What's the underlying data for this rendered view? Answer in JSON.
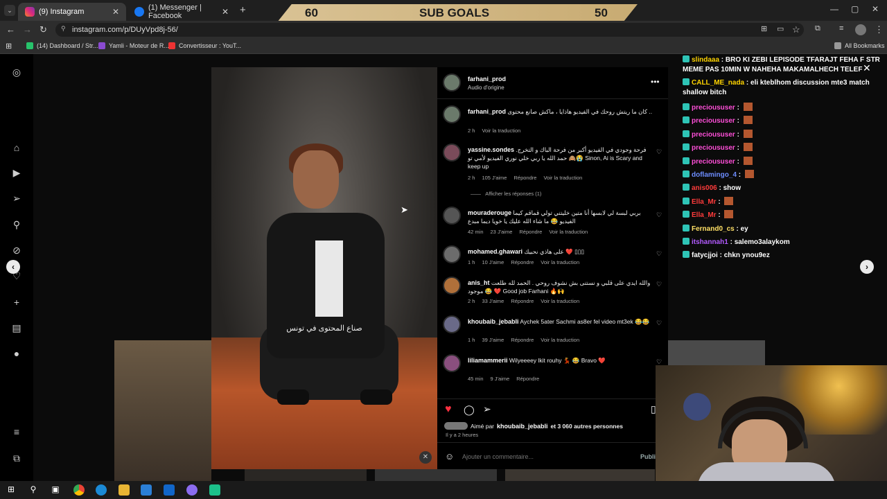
{
  "browser": {
    "tabs": [
      {
        "label": "(9) Instagram",
        "active": true
      },
      {
        "label": "(1) Messenger | Facebook",
        "active": false
      }
    ],
    "url": "instagram.com/p/DUyVpd8j-56/",
    "bookmarks": [
      "(14) Dashboard / Str...",
      "Yamli - Moteur de R...",
      "Convertisseur : YouT..."
    ],
    "all_bookmarks": "All Bookmarks"
  },
  "overlay": {
    "left_number": "60",
    "title": "SUB GOALS",
    "right_number": "50"
  },
  "video": {
    "caption": "صناع المحتوى في تونس"
  },
  "post": {
    "username": "farhani_prod",
    "audio": "Audio d'origine",
    "caption_user": "farhani_prod",
    "caption_text": "كان ما ريتش روحك في الفيديو هاذايا ، ماكش صانع محتوى ..",
    "caption_time": "2 h",
    "translate": "Voir la traduction",
    "comments": [
      {
        "user": "yassine.sondes",
        "text": "فرحة وجودي في الفيديو أكبر من فرحة الباك و التخرج. حمد الله يا ربي خلي نوري الفيديو لأمي تو 🙈😭 Sinon, Ai is Scary and keep up",
        "time": "2 h",
        "likes": "105 J'aime",
        "reply": "Répondre",
        "translate": "Voir la traduction"
      },
      {
        "user": "mouraderouge",
        "text": "بربي لبسة لي لابسها أنا متين خليتني تولي قماقم كيما الفيديو 😂 ما شاء الله عليك يا خويا ديما مبدع",
        "time": "42 min",
        "likes": "23 J'aime",
        "reply": "Répondre",
        "translate": "Voir la traduction"
      },
      {
        "user": "mohamed.ghawari",
        "text": "على هاذي نحبيك ❤️ ▯▯▯",
        "time": "1 h",
        "likes": "10 J'aime",
        "reply": "Répondre",
        "translate": "Voir la traduction"
      },
      {
        "user": "anis_ht",
        "text": "والله ايدي على قلبي و نستنى بش نشوف روحي . الحمد لله طلعت موجود 😂 ❤️ Good job Farhani 🔥🙌",
        "time": "2 h",
        "likes": "33 J'aime",
        "reply": "Répondre",
        "translate": "Voir la traduction"
      },
      {
        "user": "khoubaib_jebabli",
        "text": "Aychek 5ater Sachmi as8er fel video mt3ek 😂😂",
        "time": "1 h",
        "likes": "39 J'aime",
        "reply": "Répondre",
        "translate": "Voir la traduction"
      },
      {
        "user": "liliamammerii",
        "text": "Wilyeeeey lkit rouhy 💃 😂 Bravo ❤️",
        "time": "45 min",
        "likes": "9 J'aime",
        "reply": "Répondre",
        "translate": ""
      }
    ],
    "show_replies": "Afficher les réponses (1)",
    "liked_by_prefix": "Aimé par",
    "liked_by_user": "khoubaib_jebabli",
    "liked_by_suffix": "et 3 060 autres personnes",
    "post_time": "Il y a 2 heures",
    "comment_placeholder": "Ajouter un commentaire...",
    "publish": "Publi"
  },
  "chat": [
    {
      "user": "slindaaa",
      "text": "BRO KI ZEBI LEPISODE TFARAJT FEHA F STR MEME PAS 10MIN W NAHEHA MAKAMALHECH TELEF",
      "color": "#ffd400"
    },
    {
      "user": "CALL_ME_nada",
      "text": "eli kteblhom discussion mte3 match shallow bitch",
      "color": "#ffd400"
    },
    {
      "user": "precioususer",
      "text": "",
      "color": "#ff4fd8"
    },
    {
      "user": "precioususer",
      "text": "",
      "color": "#ff4fd8"
    },
    {
      "user": "precioususer",
      "text": "",
      "color": "#ff4fd8"
    },
    {
      "user": "precioususer",
      "text": "",
      "color": "#ff4fd8"
    },
    {
      "user": "precioususer",
      "text": "",
      "color": "#ff4fd8"
    },
    {
      "user": "doflamingo_4",
      "text": "",
      "color": "#6d8dff"
    },
    {
      "user": "anis006",
      "text": "show",
      "color": "#ff3b3b"
    },
    {
      "user": "Ella_Mr",
      "text": "",
      "color": "#ff3b3b"
    },
    {
      "user": "Ella_Mr",
      "text": "",
      "color": "#ff3b3b"
    },
    {
      "user": "Fernand0_cs",
      "text": "ey",
      "color": "#ffe066"
    },
    {
      "user": "itshannah1",
      "text": "salemo3alaykom",
      "color": "#b35bff"
    },
    {
      "user": "fatycjjoi",
      "text": "chkn ynou9ez",
      "color": "#ffffff"
    }
  ]
}
